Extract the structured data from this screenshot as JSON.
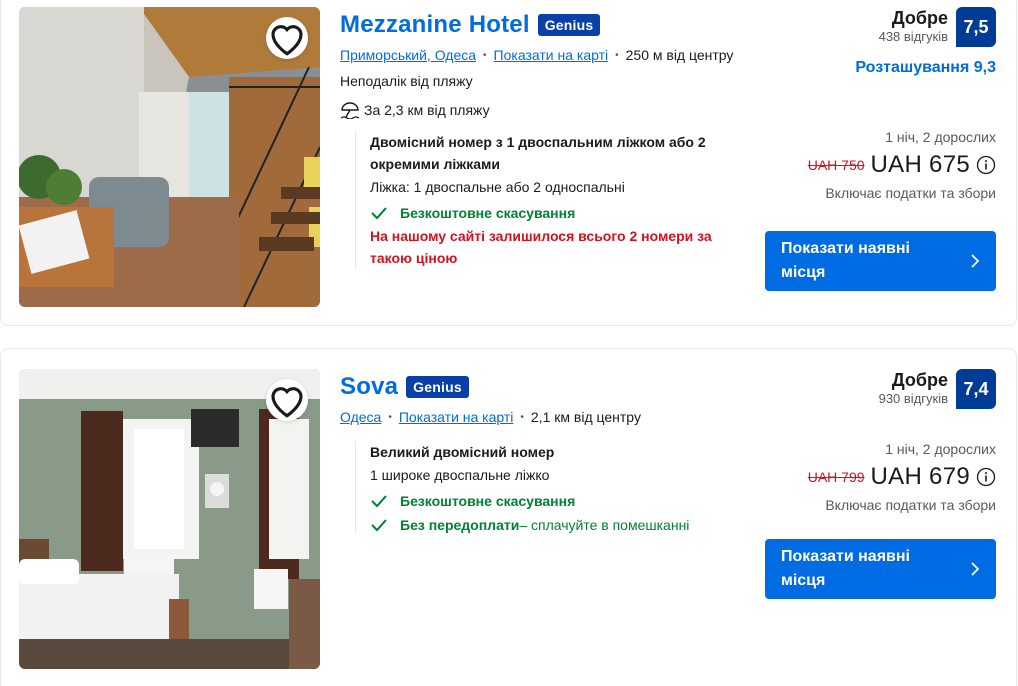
{
  "hotels": [
    {
      "name": "Mezzanine Hotel",
      "genius_label": "Genius",
      "area_link": "Приморський, Одеса",
      "map_link": "Показати на карті",
      "distance": "250 м від центру",
      "near_text": "Неподалік від пляжу",
      "beach_text": "За 2,3 км від пляжу",
      "room_title": "Двомісний номер з 1 двоспальним ліжком або 2 окремими ліжками",
      "room_beds": "Ліжка: 1 двоспальне або 2 односпальні",
      "perk1": "Безкоштовне скасування",
      "warning": "На нашому сайті залишилося всього 2 номери за такою ціною",
      "score_word": "Добре",
      "reviews": "438 відгуків",
      "score": "7,5",
      "location_score": "Розташування 9,3",
      "stay": "1 ніч, 2 дорослих",
      "old_price": "UAH 750",
      "price": "UAH 675",
      "taxes": "Включає податки та збори",
      "cta": "Показати наявні місця"
    },
    {
      "name": "Sova",
      "genius_label": "Genius",
      "area_link": "Одеса",
      "map_link": "Показати на карті",
      "distance": "2,1 км від центру",
      "room_title": "Великий двомісний номер",
      "room_beds": "1 широке двоспальне ліжко",
      "perk1": "Безкоштовне скасування",
      "perk2_bold": "Без передоплати",
      "perk2_rest": " – сплачуйте в помешканні",
      "score_word": "Добре",
      "reviews": "930 відгуків",
      "score": "7,4",
      "stay": "1 ніч, 2 дорослих",
      "old_price": "UAH 799",
      "price": "UAH 679",
      "taxes": "Включає податки та збори",
      "cta": "Показати наявні місця"
    }
  ],
  "colors": {
    "link_blue": "#006ce4",
    "score_blue": "#003b95",
    "genius_blue": "#0a3fa7",
    "green": "#008234",
    "red": "#d4111e"
  }
}
